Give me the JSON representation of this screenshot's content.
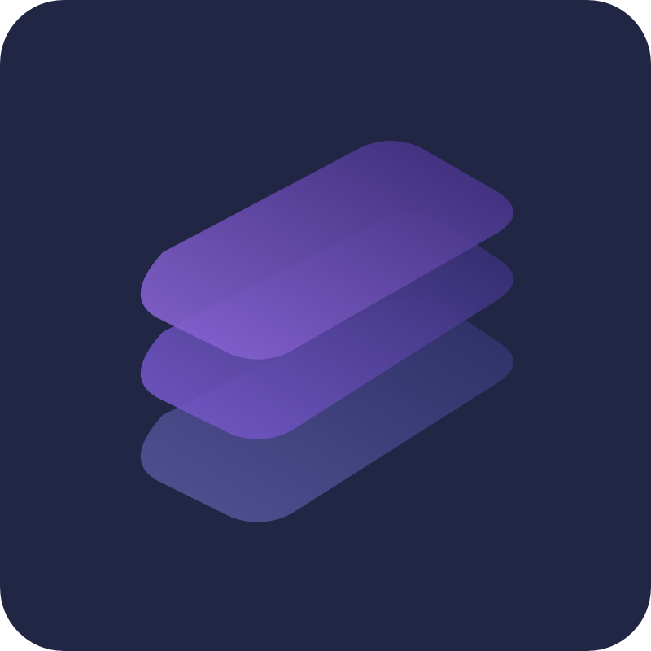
{
  "app_icon": {
    "icon": "stacked-layers-icon",
    "colors": {
      "background": "#212645",
      "layer_top_light": "#8b67d8",
      "layer_top_dark": "#3a2b78",
      "layer_middle_light": "#7a5bd0",
      "layer_middle_dark": "#2f2a6a",
      "layer_bottom_light": "#5a5aa0",
      "layer_bottom_dark": "#2e2f6a"
    }
  }
}
